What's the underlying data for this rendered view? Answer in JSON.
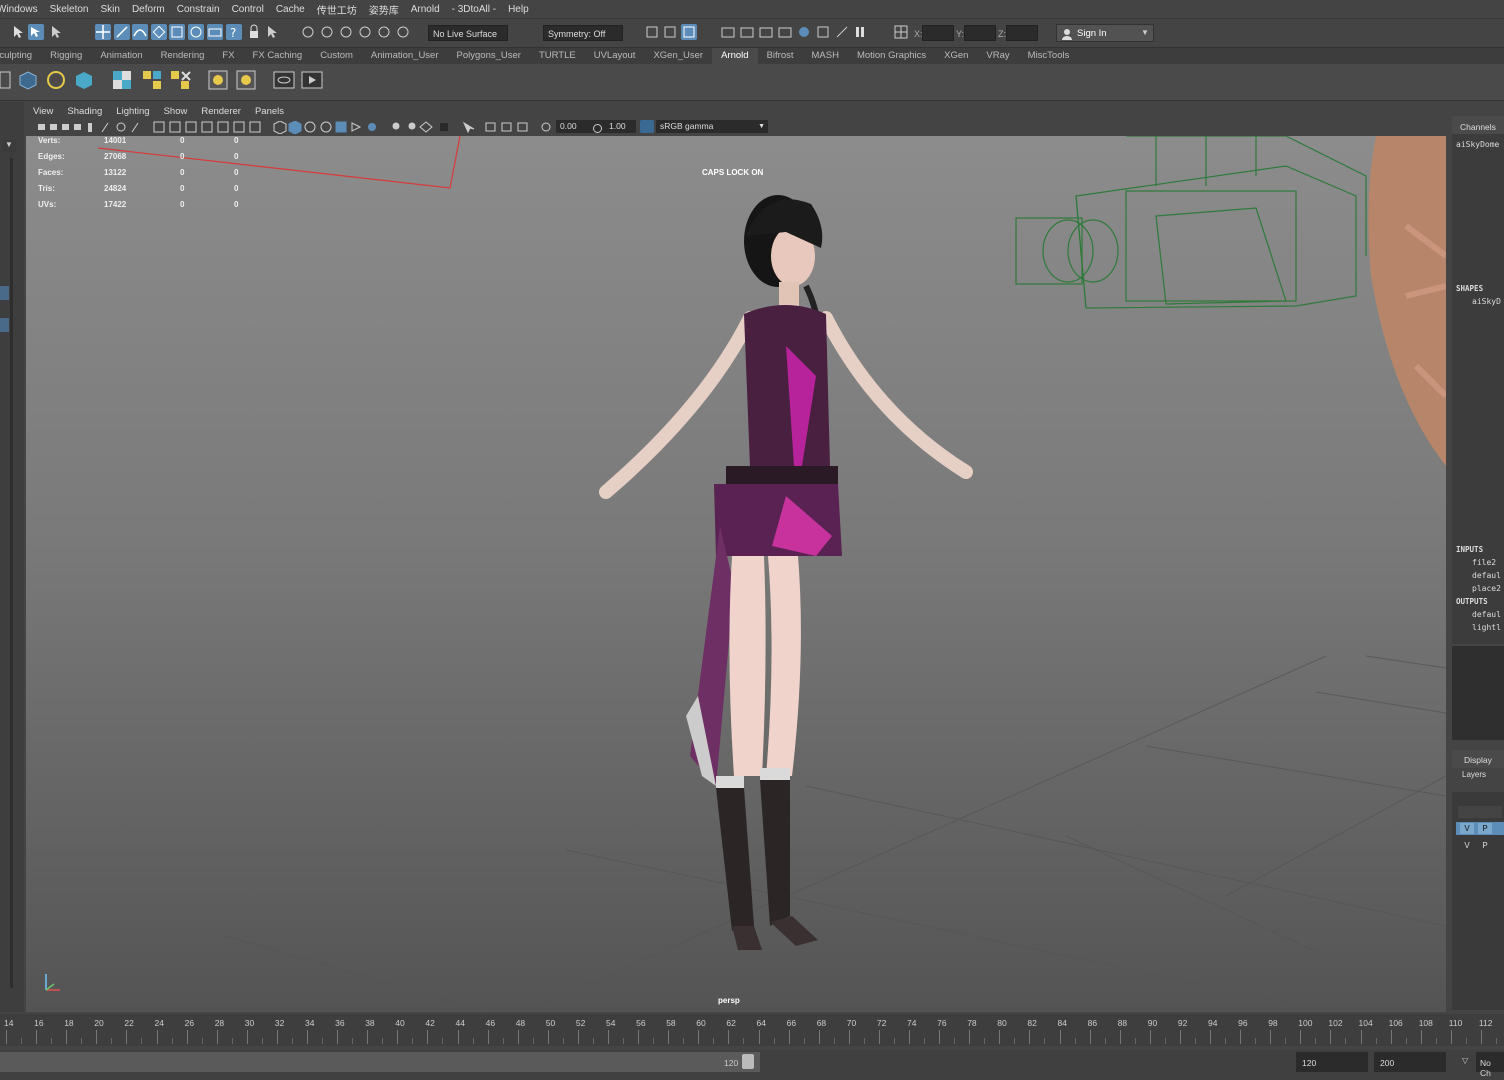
{
  "menubar": {
    "items": [
      "Windows",
      "Skeleton",
      "Skin",
      "Deform",
      "Constrain",
      "Control",
      "Cache",
      "传世工坊",
      "姿势库",
      "Arnold",
      "- 3DtoAll -",
      "Help"
    ]
  },
  "statusline": {
    "live_surface": "No Live Surface",
    "symmetry": "Symmetry: Off",
    "x_label": "X:",
    "y_label": "Y:",
    "z_label": "Z:",
    "sign_in": "Sign In"
  },
  "shelf_tabs": [
    "Sculpting",
    "Rigging",
    "Animation",
    "Rendering",
    "FX",
    "FX Caching",
    "Custom",
    "Animation_User",
    "Polygons_User",
    "TURTLE",
    "UVLayout",
    "XGen_User",
    "Arnold",
    "Bifrost",
    "MASH",
    "Motion Graphics",
    "XGen",
    "VRay",
    "MiscTools"
  ],
  "shelf_active": "Arnold",
  "viewport": {
    "menu": [
      "View",
      "Shading",
      "Lighting",
      "Show",
      "Renderer",
      "Panels"
    ],
    "exposure": "0.00",
    "gamma": "1.00",
    "color_space": "sRGB gamma",
    "caps_lock": "CAPS LOCK ON",
    "camera": "persp",
    "hud": [
      {
        "label": "Verts:",
        "a": "14001",
        "b": "0",
        "c": "0"
      },
      {
        "label": "Edges:",
        "a": "27068",
        "b": "0",
        "c": "0"
      },
      {
        "label": "Faces:",
        "a": "13122",
        "b": "0",
        "c": "0"
      },
      {
        "label": "Tris:",
        "a": "24824",
        "b": "0",
        "c": "0"
      },
      {
        "label": "UVs:",
        "a": "17422",
        "b": "0",
        "c": "0"
      }
    ]
  },
  "channel_box": {
    "tab": "Channels",
    "object": "aiSkyDome",
    "shapes_header": "SHAPES",
    "shape": "aiSkyD",
    "inputs_header": "INPUTS",
    "inputs": [
      "file2",
      "defaul",
      "place2"
    ],
    "outputs_header": "OUTPUTS",
    "outputs": [
      "defaul",
      "lightl"
    ]
  },
  "layer_editor": {
    "display_tab": "Display",
    "layers_tab": "Layers",
    "row1": [
      "V",
      "P"
    ],
    "row2": [
      "V",
      "P"
    ]
  },
  "timeline": {
    "ticks": [
      "14",
      "16",
      "18",
      "20",
      "22",
      "24",
      "26",
      "28",
      "30",
      "32",
      "34",
      "36",
      "38",
      "40",
      "42",
      "44",
      "46",
      "48",
      "50",
      "52",
      "54",
      "56",
      "58",
      "60",
      "62",
      "64",
      "66",
      "68",
      "70",
      "72",
      "74",
      "76",
      "78",
      "80",
      "82",
      "84",
      "86",
      "88",
      "90",
      "92",
      "94",
      "96",
      "98",
      "100",
      "102",
      "104",
      "106",
      "108",
      "110",
      "112"
    ]
  },
  "range": {
    "slider_end": "120",
    "playback_end": "120",
    "animation_end": "200",
    "char_set": "No Ch"
  }
}
